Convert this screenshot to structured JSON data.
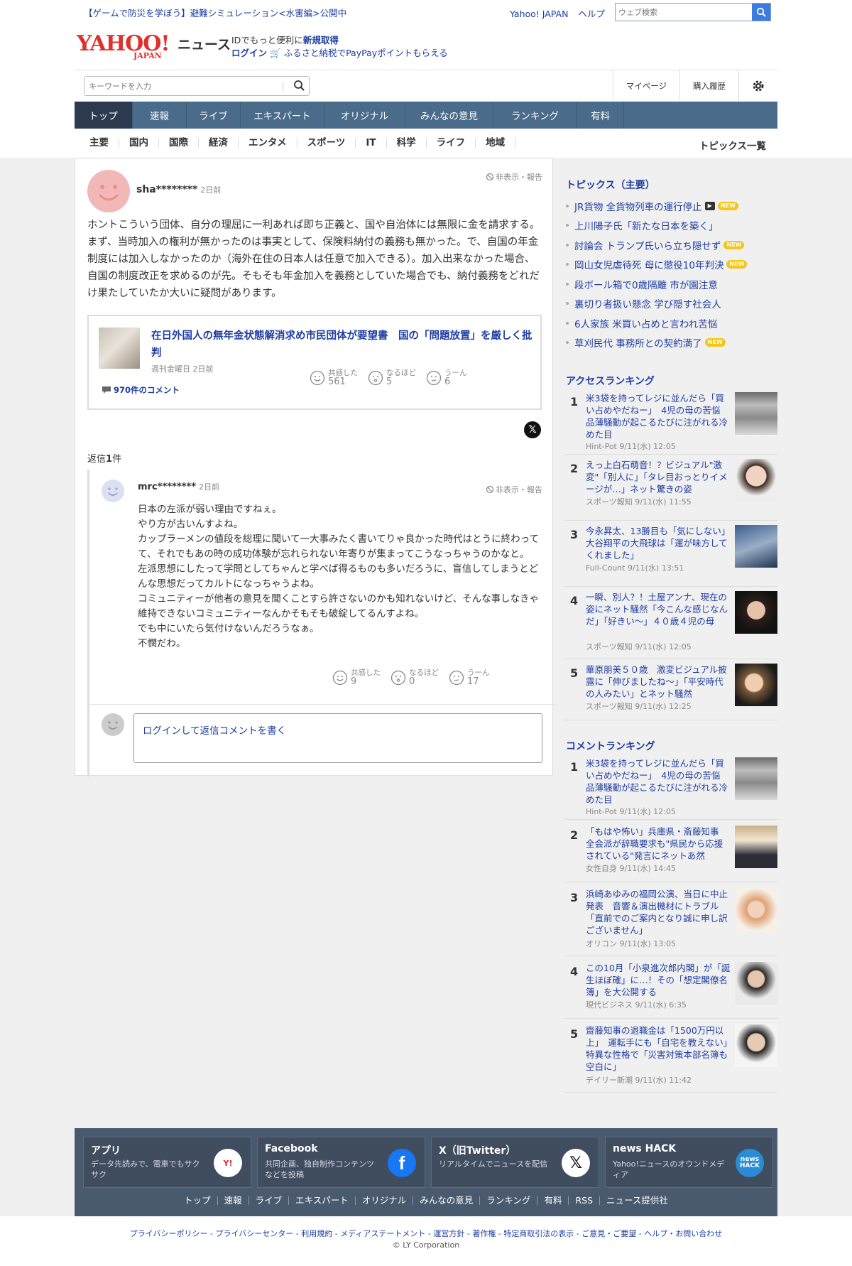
{
  "header": {
    "promo": "【ゲームで防災を学ぼう】避難シミュレーション<水害編>公開中",
    "yahoo_japan_link": "Yahoo! JAPAN",
    "help_link": "ヘルプ",
    "web_search_placeholder": "ウェブ検索",
    "logo_text": "YAHOO!",
    "logo_sub": "JAPAN",
    "logo_news": "ニュース",
    "id_promo_line1_prefix": "IDでもっと便利に",
    "id_promo_line1_link": "新規取得",
    "id_promo_login": "ログイン",
    "id_promo_line2": "ふるさと納税でPayPayポイントもらえる",
    "keyword_placeholder": "キーワードを入力",
    "mypage": "マイページ",
    "history": "購入履歴"
  },
  "global_nav": [
    "トップ",
    "速報",
    "ライブ",
    "エキスパート",
    "オリジナル",
    "みんなの意見",
    "ランキング",
    "有料"
  ],
  "category_nav": [
    "主要",
    "国内",
    "国際",
    "経済",
    "エンタメ",
    "スポーツ",
    "IT",
    "科学",
    "ライフ",
    "地域"
  ],
  "category_all": "トピックス一覧",
  "comment": {
    "user": "sha********",
    "time": "2日前",
    "report": "非表示・報告",
    "body": "ホントこういう団体、自分の理屈に一利あれば即ち正義と、国や自治体には無限に金を請求する。まず、当時加入の権利が無かったのは事実として、保険料納付の義務も無かった。で、自国の年金制度には加入しなかったのか（海外在住の日本人は任意で加入できる）。加入出来なかった場合、自国の制度改正を求めるのが先。そもそも年金加入を義務としていた場合でも、納付義務をどれだけ果たしていたか大いに疑問があります。",
    "article": {
      "title": "在日外国人の無年金状態解消求め市民団体が要望書　国の「問題放置」を厳しく批判",
      "source": "週刊金曜日",
      "time": "2日前",
      "comments": "970件のコメント"
    },
    "reactions": [
      {
        "label": "共感した",
        "count": "561"
      },
      {
        "label": "なるほど",
        "count": "5"
      },
      {
        "label": "うーん",
        "count": "6"
      }
    ],
    "x_share": "𝕏"
  },
  "replies_label_prefix": "返信",
  "replies_label_count": "1",
  "replies_label_suffix": "件",
  "reply": {
    "user": "mrc********",
    "time": "2日前",
    "report": "非表示・報告",
    "lines": [
      "日本の左派が弱い理由ですねぇ。",
      "やり方が古いんすよね。",
      "カップラーメンの値段を総理に聞いて一大事みたく書いてりゃ良かった時代はとうに終わってて、それでもあの時の成功体験が忘れられない年寄りが集まってこうなっちゃうのかなと。",
      "左派思想にしたって学問としてちゃんと学べば得るものも多いだろうに、盲信してしまうとどんな思想だってカルトになっちゃうよね。",
      "コミュニティーが他者の意見を聞くことすら許さないのかも知れないけど、そんな事しなきゃ維持できないコミュニティーなんかそもそも破綻してるんすよね。",
      "でも中にいたら気付けないんだろうなぁ。",
      "不憫だわ。"
    ],
    "reactions": [
      {
        "label": "共感した",
        "count": "9"
      },
      {
        "label": "なるほど",
        "count": "0"
      },
      {
        "label": "うーん",
        "count": "17"
      }
    ],
    "reply_login": "ログイン",
    "reply_prompt": "して返信コメントを書く"
  },
  "sidebar": {
    "topics_title": "トピックス（主要）",
    "topics": [
      {
        "text": "JR貨物 全貨物列車の運行停止",
        "video": true,
        "new": true
      },
      {
        "text": "上川陽子氏「新たな日本を築く」",
        "video": false,
        "new": false
      },
      {
        "text": "討論会 トランプ氏いら立ち隠せず",
        "video": false,
        "new": true
      },
      {
        "text": "岡山女児虐待死 母に懲役10年判決",
        "video": false,
        "new": true
      },
      {
        "text": "段ボール箱で0歳隔離 市が園注意",
        "video": false,
        "new": false
      },
      {
        "text": "裏切り者扱い懸念 学び隠す社会人",
        "video": false,
        "new": false
      },
      {
        "text": "6人家族 米買い占めと言われ苦悩",
        "video": false,
        "new": false
      },
      {
        "text": "草刈民代 事務所との契約満了",
        "video": false,
        "new": true
      }
    ],
    "video_badge": "▶",
    "new_badge": "NEW",
    "access_title": "アクセスランキング",
    "access": [
      {
        "no": "1",
        "title": "米3袋を持ってレジに並んだら「買い占めやだねー」　4児の母の苦悩　品薄騒動が起こるたびに注がれる冷めた目",
        "meta": "Hint-Pot 9/11(水) 12:05"
      },
      {
        "no": "2",
        "title": "えっ上白石萌音！？ビジュアル\"激変\"「別人に」「タレ目おっとりイメージが…」ネット驚きの姿",
        "meta": "スポーツ報知 9/11(水) 11:55"
      },
      {
        "no": "3",
        "title": "今永昇太、13勝目も「気にしない」　大谷翔平の大飛球は「運が味方してくれました」",
        "meta": "Full-Count 9/11(水) 13:51"
      },
      {
        "no": "4",
        "title": "一瞬、別人？！土屋アンナ、現在の姿にネット騒然「今こんな感じなんだ」「好きい～」４０歳４児の母",
        "meta": "スポーツ報知 9/11(水) 12:05"
      },
      {
        "no": "5",
        "title": "華原朋美５０歳　激変ビジュアル披露に「伸びましたね～」「平安時代の人みたい」とネット騒然",
        "meta": "スポーツ報知 9/11(水) 12:25"
      }
    ],
    "comment_title": "コメントランキング",
    "comment_rank": [
      {
        "no": "1",
        "title": "米3袋を持ってレジに並んだら「買い占めやだねー」　4児の母の苦悩　品薄騒動が起こるたびに注がれる冷めた目",
        "meta": "Hint-Pot 9/11(水) 12:05"
      },
      {
        "no": "2",
        "title": "「もはや怖い」兵庫県・斎藤知事　全会派が辞職要求も\"県民から応援されている\"発言にネットあ然",
        "meta": "女性自身 9/11(水) 14:45"
      },
      {
        "no": "3",
        "title": "浜崎あゆみの福岡公演、当日に中止発表　音響＆演出機材にトラブル「直前でのご案内となり誠に申し訳ございません」",
        "meta": "オリコン 9/11(水) 13:05"
      },
      {
        "no": "4",
        "title": "この10月「小泉進次郎内閣」が「誕生ほぼ確」に…！その「想定閣僚名簿」を大公開する",
        "meta": "現代ビジネス 9/11(水) 6:35"
      },
      {
        "no": "5",
        "title": "齋藤知事の退職金は「1500万円以上」　運転手にも「自宅を教えない」特異な性格で「災害対策本部名簿も空白に」",
        "meta": "デイリー新潮 9/11(水) 11:42"
      }
    ]
  },
  "footer": {
    "cards": [
      {
        "title": "アプリ",
        "desc": "データ先読みで、電車でもサクサク",
        "icon": "Y!"
      },
      {
        "title": "Facebook",
        "desc": "共同企画、独自制作コンテンツなどを投稿",
        "icon": "f"
      },
      {
        "title": "X（旧Twitter）",
        "desc": "リアルタイムでニュースを配信",
        "icon": "𝕏"
      },
      {
        "title": "news HACK",
        "desc": "Yahoo!ニュースのオウンドメディア",
        "icon": "news HACK"
      }
    ],
    "links": [
      "トップ",
      "速報",
      "ライブ",
      "エキスパート",
      "オリジナル",
      "みんなの意見",
      "ランキング",
      "有料",
      "RSS",
      "ニュース提供社"
    ],
    "legal": "プライバシーポリシー - プライバシーセンター - 利用規約 - メディアステートメント - 運営方針 - 著作権 - 特定商取引法の表示 - ご意見・ご要望 - ヘルプ・お問い合わせ",
    "copyright": "© LY Corporation"
  },
  "colors": {
    "link": "#1f3ea3",
    "brand_red": "#e0302c",
    "nav_bg": "#4a6b8a",
    "nav_active": "#2b3a4f",
    "footer_bg": "#4a5a6e"
  }
}
